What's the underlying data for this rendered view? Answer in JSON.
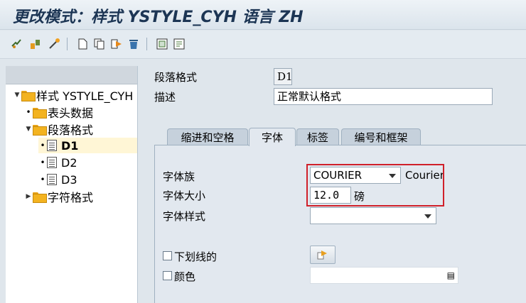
{
  "title": "更改模式：样式 YSTYLE_CYH 语言 ZH",
  "toolbar": {
    "icons": [
      "display-change-icon",
      "activate-icon",
      "check-icon",
      "new-icon",
      "copy-icon",
      "forward-icon",
      "delete-icon",
      "header-data-icon",
      "paragraph-format-icon"
    ]
  },
  "tree": {
    "root": "样式 YSTYLE_CYH",
    "header_data": "表头数据",
    "paragraph_formats": "段落格式",
    "items": [
      "D1",
      "D2",
      "D3"
    ],
    "char_formats": "字符格式"
  },
  "form": {
    "paragraph_label": "段落格式",
    "paragraph_value": "D1",
    "desc_label": "描述",
    "desc_value": "正常默认格式"
  },
  "tabs": [
    "缩进和空格",
    "字体",
    "标签",
    "编号和框架"
  ],
  "font_tab": {
    "family_label": "字体族",
    "family_value": "COURIER",
    "family_desc": "Courier",
    "size_label": "字体大小",
    "size_value": "12.0",
    "size_unit": "磅",
    "style_label": "字体样式",
    "style_value": "",
    "underline_label": "下划线的",
    "color_label": "颜色"
  },
  "colors": {
    "highlight": "#d0202a",
    "folder": "#f3b320"
  }
}
